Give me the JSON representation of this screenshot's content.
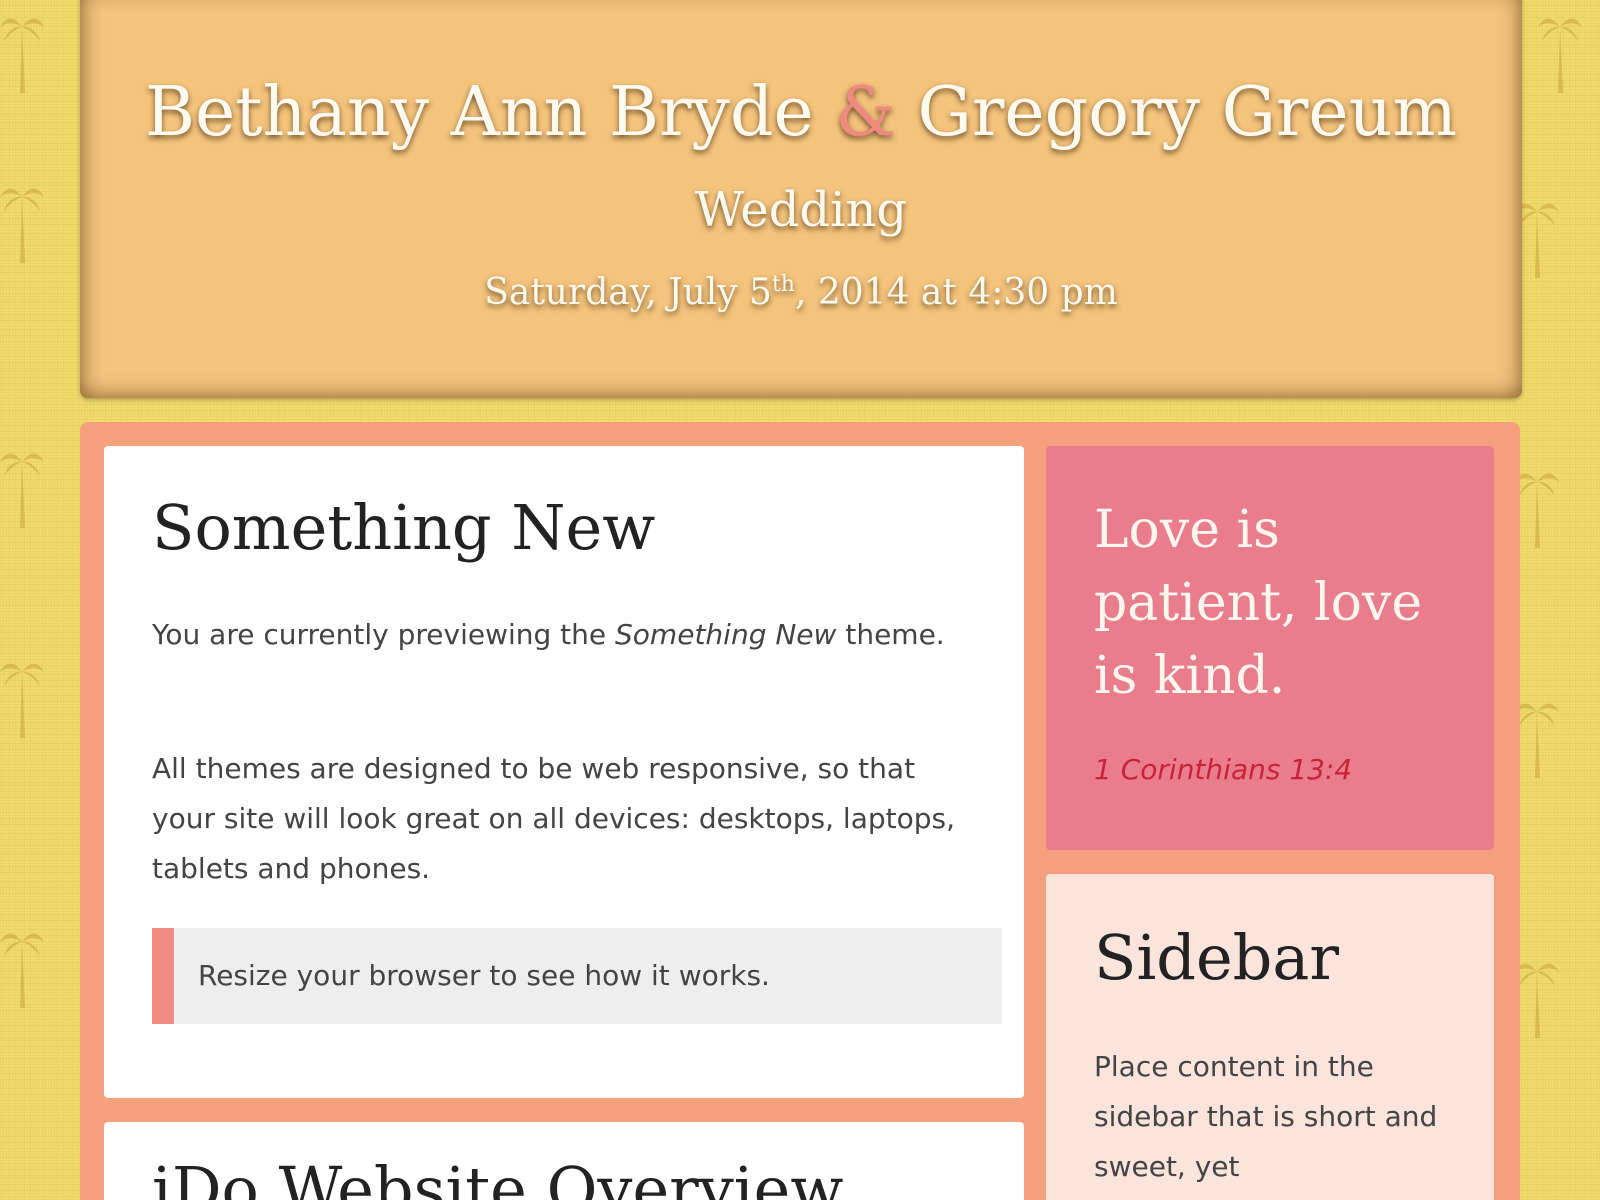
{
  "header": {
    "name_one": "Bethany Ann Bryde",
    "ampersand": "&",
    "name_two": "Gregory Greum",
    "event": "Wedding",
    "date_prefix": "Saturday, July 5",
    "date_ordinal": "th",
    "date_suffix": ", 2014 at 4:30 pm"
  },
  "main": {
    "title": "Something New",
    "intro_prefix": "You are currently previewing the ",
    "intro_theme": "Something New",
    "intro_suffix": " theme.",
    "responsive_text": "All themes are designed to be web responsive, so that your site will look great on all devices: desktops, laptops, tablets and phones.",
    "callout": "Resize your browser to see how it works.",
    "second_title": "iDo Website Overview"
  },
  "quote": {
    "text": "Love is patient, love is kind.",
    "reference": "1 Corinthians 13:4"
  },
  "sidebar": {
    "title": "Sidebar",
    "text": "Place content in the sidebar that is short and sweet, yet"
  },
  "colors": {
    "background": "#f2dc6e",
    "header_bg": "#f4c47d",
    "accent": "#ef8a80",
    "content_wrap": "#f4a07d",
    "quote_bg": "#e97d8b",
    "quote_ref": "#c8233b",
    "sidebar_bg": "#fbe4dc"
  },
  "icons": {
    "background_pattern": "palm-tree-icon"
  }
}
